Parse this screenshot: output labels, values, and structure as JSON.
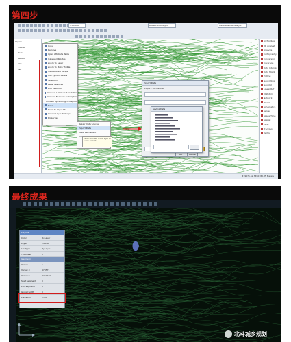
{
  "panel1": {
    "step_title": "第四步",
    "toolbar": {
      "combo1": "1:10,000",
      "combo2": "Advanced Analysis",
      "combo3": "Geostatistical Analyst"
    },
    "toc_items": [
      "Layers",
      "contour",
      "dem",
      "Results",
      "Clip",
      "vec"
    ],
    "context_menu": [
      "Copy",
      "Remove",
      "Open Attribute Table",
      "Joins and Relates",
      "Zoom To Layer",
      "Zoom To Make Visible",
      "Visible Scale Range",
      "Use Symbol Levels",
      "Selection",
      "Label Features",
      "Edit Features",
      "Convert Labels to Annotation",
      "Convert Features to Graphics",
      "Convert Symbology to Representation",
      "Data",
      "Save As Layer File",
      "Create Layer Package",
      "Properties"
    ],
    "submenu": [
      "Repair Data Source",
      "Export Data",
      "Make Permanent",
      "View Item Description"
    ],
    "tooltip": "Export the data in this layer to a new dataset",
    "dialog": {
      "title": "Export Data",
      "text": "Export: All features",
      "ok": "OK",
      "cancel": "Cancel"
    },
    "file_dialog": {
      "title": "Saving Data"
    },
    "right_panel_items": [
      "ArcToolbox",
      "3D Analyst",
      "Analysis",
      "Cartography",
      "Conversion",
      "Coverage",
      "Data Interop",
      "Data Mgmt",
      "Editing",
      "Geocoding",
      "Geostat",
      "Linear Ref",
      "Multidim",
      "Network",
      "Parcel",
      "Schematics",
      "Server",
      "Space Time",
      "Spatial",
      "Stats",
      "Tracking",
      "Vector"
    ],
    "status_text": "479571.52  3450180.35 Meters"
  },
  "panel2": {
    "step_title": "最终成果",
    "properties": {
      "header": "Polyline",
      "general_rows": [
        {
          "k": "Color",
          "v": "ByLayer"
        },
        {
          "k": "Layer",
          "v": "contour"
        },
        {
          "k": "Linetype",
          "v": "ByLayer"
        },
        {
          "k": "Thickness",
          "v": "0"
        }
      ],
      "geometry_header": "Geometry",
      "geometry_rows": [
        {
          "k": "Vertex",
          "v": "1"
        },
        {
          "k": "Vertex X",
          "v": "479571"
        },
        {
          "k": "Vertex Y",
          "v": "3450180"
        },
        {
          "k": "Start segment",
          "v": "0"
        },
        {
          "k": "End segment",
          "v": "0"
        },
        {
          "k": "Global width",
          "v": "0"
        },
        {
          "k": "Elevation",
          "v": "1560"
        }
      ]
    }
  },
  "watermark": "北斗城乡规划",
  "colors": {
    "step_red": "#d9251d",
    "contour_green": "#3a9a3a",
    "highlight_red": "#d11c1c",
    "dark_bg": "#0a0a0a"
  }
}
